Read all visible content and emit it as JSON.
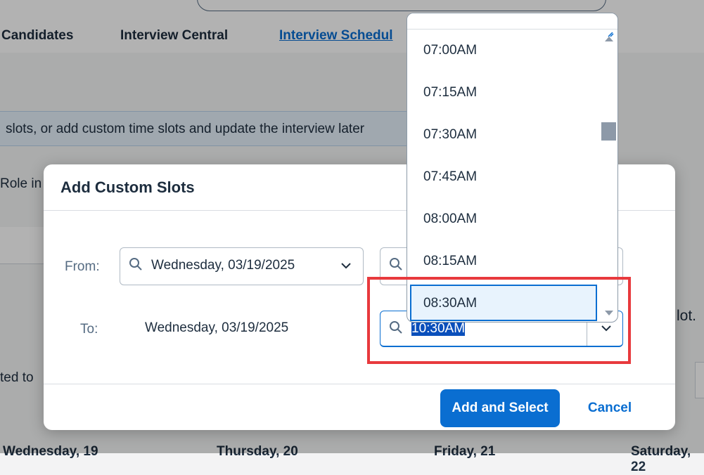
{
  "background": {
    "tabs": [
      "Candidates",
      "Interview Central",
      "Interview Schedul"
    ],
    "info_text": "slots, or add custom time slots and update the interview later",
    "role_text": "Role in",
    "ted_text": "ted to",
    "slot_text": "lot.",
    "days": [
      "Wednesday, 19",
      "Thursday, 20",
      "Friday, 21",
      "Saturday, 22"
    ]
  },
  "dialog": {
    "title": "Add Custom Slots",
    "from_label": "From:",
    "to_label": "To:",
    "from_date": "Wednesday, 03/19/2025",
    "to_date": "Wednesday, 03/19/2025",
    "to_time": "10:30AM",
    "add_button": "Add and Select",
    "cancel_button": "Cancel"
  },
  "dropdown": {
    "options": [
      "07:00AM",
      "07:15AM",
      "07:30AM",
      "07:45AM",
      "08:00AM",
      "08:15AM",
      "08:30AM"
    ],
    "selected": "08:30AM"
  },
  "colors": {
    "accent": "#0a6ed1",
    "highlight": "#e8393d"
  }
}
